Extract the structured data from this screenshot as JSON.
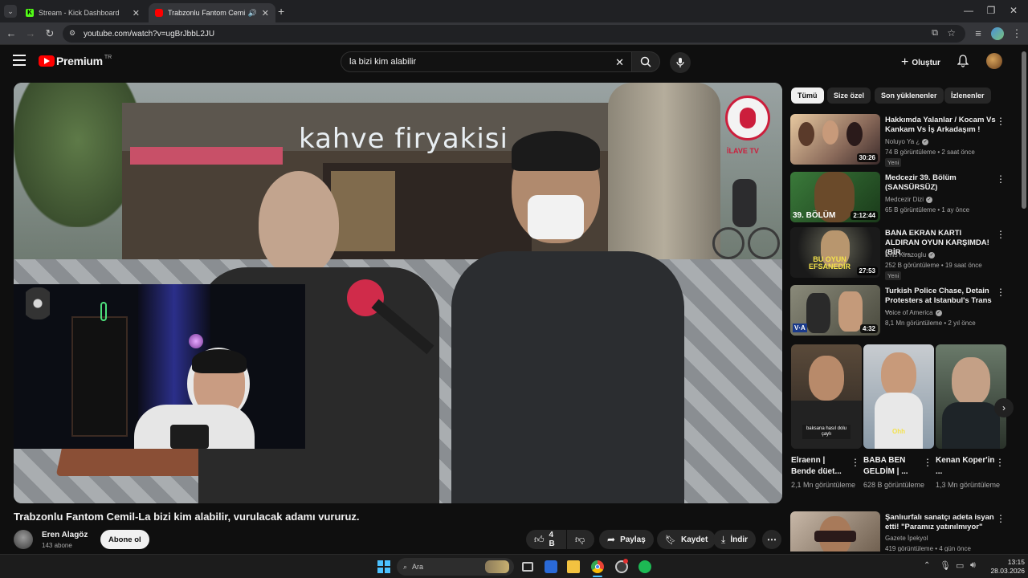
{
  "browser": {
    "tabs": [
      {
        "title": "Stream - Kick Dashboard"
      },
      {
        "title": "Trabzonlu Fantom Cemil-La"
      }
    ],
    "url": "youtube.com/watch?v=ugBrJbbL2JU"
  },
  "header": {
    "logo_text": "Premium",
    "logo_region": "TR",
    "search_value": "la bizi kim alabilir",
    "create_label": "Oluştur"
  },
  "player": {
    "overlay_sign": "kahve firyakisi",
    "overlay_logo": "İLAVE TV"
  },
  "video": {
    "title": "Trabzonlu Fantom Cemil-La bizi kim alabilir, vurulacak adamı vururuz.",
    "channel_name": "Eren Alagöz",
    "subscribers": "143 abone",
    "subscribe_label": "Abone ol",
    "likes": "4 B",
    "share_label": "Paylaş",
    "save_label": "Kaydet",
    "download_label": "İndir"
  },
  "chips": [
    "Tümü",
    "Size özel",
    "Son yüklenenler",
    "İzlenenler"
  ],
  "recommendations": [
    {
      "title": "Hakkımda Yalanlar / Kocam Vs Kankam Vs İş Arkadaşım !",
      "channel": "Noluyo Ya ¿",
      "views": "74 B görüntüleme",
      "age": "2 saat önce",
      "duration": "30:26",
      "badge": "Yeni"
    },
    {
      "title": "Medcezir 39. Bölüm (SANSÜRSÜZ)",
      "channel": "Medcezir Dizi",
      "views": "65 B görüntüleme",
      "age": "1 ay önce",
      "duration": "2:12:44",
      "thumb_text": "39. BÖLÜM"
    },
    {
      "title": "BANA EKRAN KARTI ALDIRAN OYUN KARŞIMDA! (BİR ...",
      "channel": "Enis Kirazoglu",
      "views": "252 B görüntüleme",
      "age": "19 saat önce",
      "duration": "27:53",
      "badge": "Yeni",
      "thumb_text": "BU OYUN EFSANEDİR"
    },
    {
      "title": "Turkish Police Chase, Detain Protesters at Istanbul's Trans ...",
      "channel": "Voice of America",
      "views": "8,1 Mn görüntüleme",
      "age": "2 yıl önce",
      "duration": "4:32",
      "thumb_text": "V·A"
    }
  ],
  "shorts": [
    {
      "title": "Elraenn | Bende düet...",
      "views": "2,1 Mn görüntüleme",
      "caption": "baksana hasıl dolu çaylı"
    },
    {
      "title": "BABA BEN GELDİM | ...",
      "views": "628 B görüntüleme",
      "caption": "Ohh"
    },
    {
      "title": "Kenan Koper'in ...",
      "views": "1,3 Mn görüntüleme"
    }
  ],
  "last_rec": {
    "title": "Şanlıurfalı sanatçı adeta isyan etti! \"Paramız yatınılmıyor\"",
    "channel": "Gazete İpekyol",
    "views": "419 görüntüleme",
    "age": "4 gün önce"
  },
  "taskbar": {
    "search_label": "Ara",
    "time": "13:15",
    "date": "28.03.2026"
  },
  "colors": {
    "brand_red": "#ff0000",
    "background": "#0f0f0f",
    "kick_green": "#53fc18"
  }
}
